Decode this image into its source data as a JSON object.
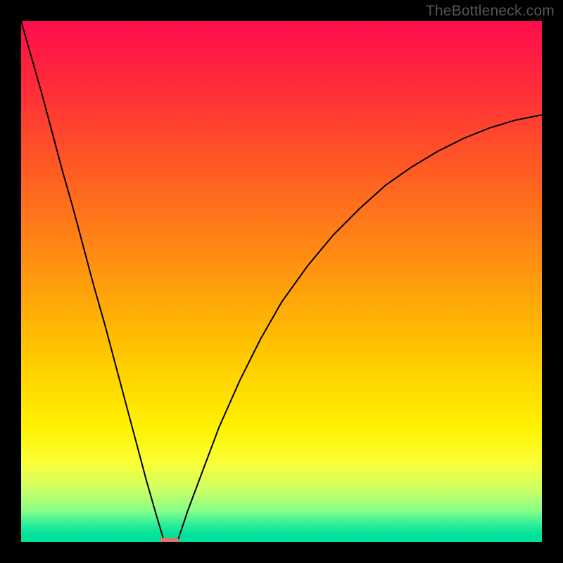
{
  "watermark": "TheBottleneck.com",
  "chart_data": {
    "type": "line",
    "title": "",
    "xlabel": "",
    "ylabel": "",
    "xlim": [
      0,
      100
    ],
    "ylim": [
      0,
      100
    ],
    "grid": false,
    "legend": false,
    "background": {
      "description": "vertical gradient, red at top through orange/yellow to green at bottom",
      "stops": [
        {
          "pos": 0.0,
          "color": "#ff0d4c"
        },
        {
          "pos": 0.12,
          "color": "#ff2a3a"
        },
        {
          "pos": 0.28,
          "color": "#ff5a24"
        },
        {
          "pos": 0.45,
          "color": "#ff8c12"
        },
        {
          "pos": 0.62,
          "color": "#ffc100"
        },
        {
          "pos": 0.78,
          "color": "#fff200"
        },
        {
          "pos": 0.85,
          "color": "#faff3a"
        },
        {
          "pos": 0.9,
          "color": "#ccff66"
        },
        {
          "pos": 0.94,
          "color": "#88ff88"
        },
        {
          "pos": 0.965,
          "color": "#33ef99"
        },
        {
          "pos": 0.985,
          "color": "#00e39c"
        },
        {
          "pos": 1.0,
          "color": "#00e09a"
        }
      ]
    },
    "series": [
      {
        "name": "left-branch",
        "x": [
          0,
          2,
          4,
          6,
          8,
          10,
          12,
          14,
          16,
          18,
          20,
          22,
          24,
          26,
          27.5
        ],
        "y": [
          100,
          93,
          86,
          78.5,
          71,
          64,
          56.5,
          49,
          42,
          34.5,
          27,
          19.5,
          12,
          5,
          0
        ]
      },
      {
        "name": "right-branch",
        "x": [
          30,
          32,
          35,
          38,
          42,
          46,
          50,
          55,
          60,
          65,
          70,
          75,
          80,
          85,
          90,
          95,
          100
        ],
        "y": [
          0,
          6,
          14,
          22,
          31,
          39,
          46,
          53,
          59,
          64,
          68.5,
          72,
          75,
          77.5,
          79.5,
          81,
          82
        ]
      }
    ],
    "marker": {
      "name": "minimum-marker",
      "shape": "rounded-rect",
      "x": 28.5,
      "y": 0,
      "color": "#cf7b6a"
    }
  }
}
